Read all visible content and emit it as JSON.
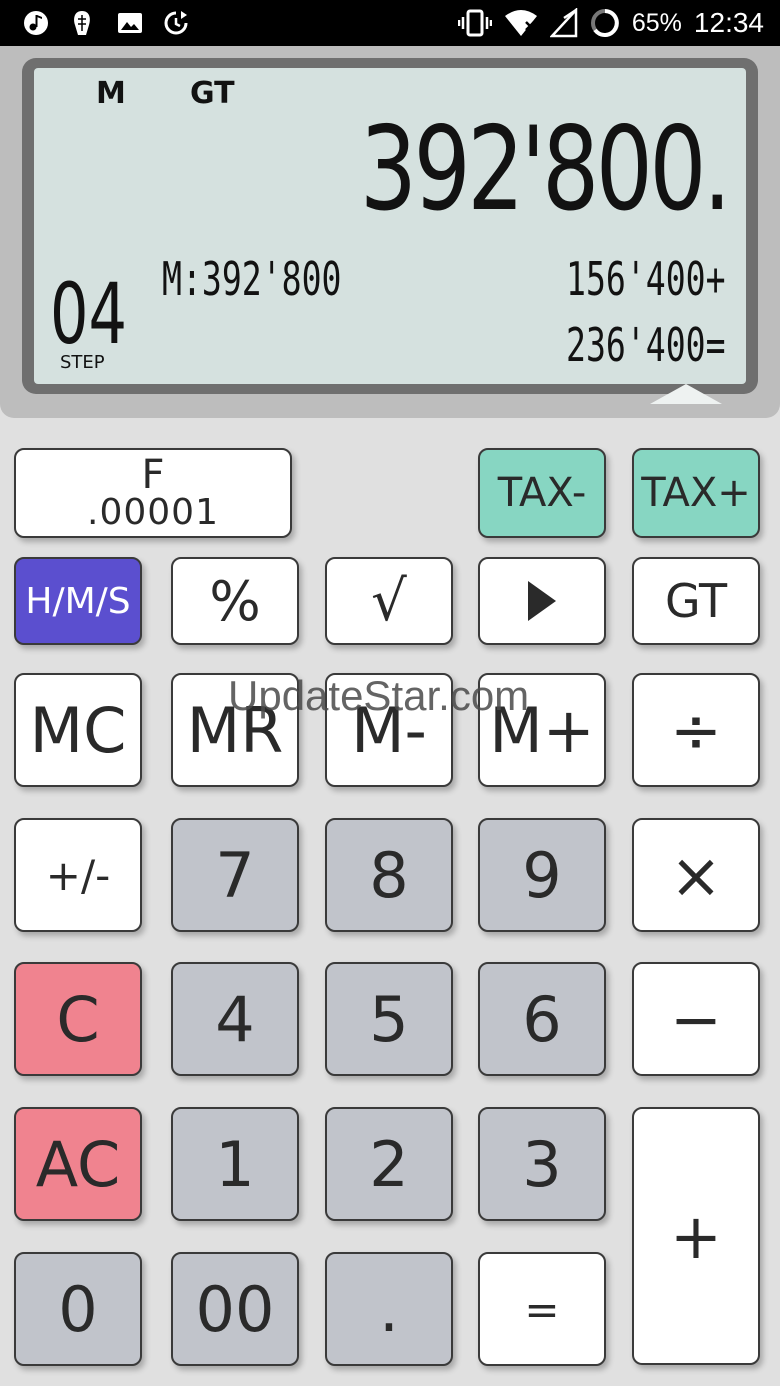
{
  "status_bar": {
    "icons": [
      "music-icon",
      "app-icon",
      "image-icon",
      "sync-icon"
    ],
    "right_icons": [
      "vibrate-icon",
      "wifi-icon",
      "no-signal-icon",
      "battery-icon"
    ],
    "battery": "65%",
    "time": "12:34"
  },
  "display": {
    "indicators": {
      "memory": "M",
      "grand_total": "GT"
    },
    "main_value": "392'800.",
    "memory_line": "M:392'800",
    "step_value": "04",
    "step_label": "STEP",
    "tape": [
      "156'400+",
      "236'400="
    ]
  },
  "keys": {
    "f_top": "F",
    "f_bottom": ".00001",
    "tax_minus": "TAX-",
    "tax_plus": "TAX+",
    "hms": "H/M/S",
    "percent": "%",
    "sqrt": "√",
    "play": "▶",
    "gt": "GT",
    "mc": "MC",
    "mr": "MR",
    "m_minus": "M-",
    "m_plus": "M+",
    "divide": "÷",
    "sign": "+/-",
    "d7": "7",
    "d8": "8",
    "d9": "9",
    "multiply": "×",
    "clear": "C",
    "d4": "4",
    "d5": "5",
    "d6": "6",
    "minus": "−",
    "all_clear": "AC",
    "d1": "1",
    "d2": "2",
    "d3": "3",
    "plus": "+",
    "d0": "0",
    "d00": "00",
    "decimal": ".",
    "equals": "="
  },
  "watermark": "UpdateStar.com",
  "colors": {
    "tax_keys": "#87d6c2",
    "hms_key": "#5b4fcf",
    "clear_keys": "#f0838f",
    "digit_keys": "#c1c4cb",
    "lcd_background": "#d5e1df"
  }
}
